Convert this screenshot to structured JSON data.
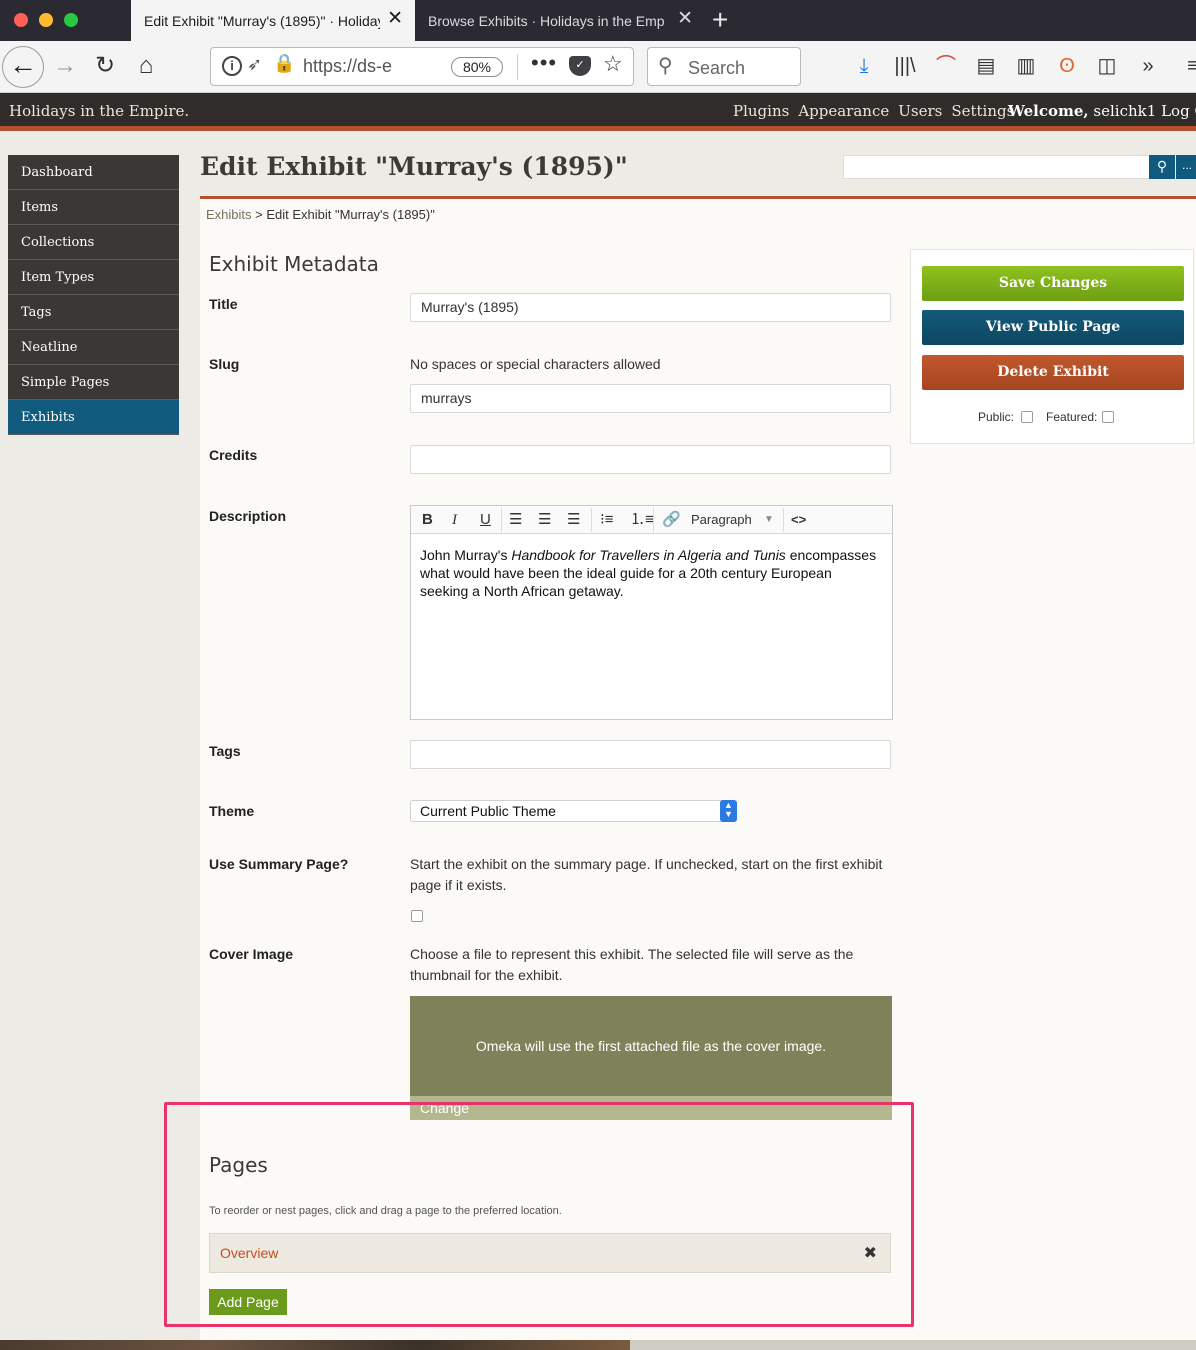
{
  "browser": {
    "tabs": [
      {
        "title": "Edit Exhibit \"Murray's (1895)\" · Holidays in the Empire",
        "close": "✕"
      },
      {
        "title": "Browse Exhibits · Holidays in the Empire",
        "close": "✕"
      }
    ],
    "new_tab": "+",
    "url": "https://ds-e",
    "zoom": "80%",
    "more": "•••",
    "search_placeholder": "Search"
  },
  "site": {
    "title": "Holidays in the Empire.",
    "nav": [
      "Plugins",
      "Appearance",
      "Users",
      "Settings"
    ],
    "welcome": "Welcome,",
    "username": "selichk1",
    "logout": "Log Out"
  },
  "sidebar": {
    "items": [
      {
        "label": "Dashboard"
      },
      {
        "label": "Items"
      },
      {
        "label": "Collections"
      },
      {
        "label": "Item Types"
      },
      {
        "label": "Tags"
      },
      {
        "label": "Neatline"
      },
      {
        "label": "Simple Pages"
      },
      {
        "label": "Exhibits"
      }
    ],
    "active": "Exhibits"
  },
  "page": {
    "heading": "Edit Exhibit \"Murray's (1895)\"",
    "search_button": "⚲",
    "search_more": "...",
    "breadcrumb_link": "Exhibits",
    "breadcrumb_rest": " > Edit Exhibit \"Murray's (1895)\""
  },
  "form": {
    "section_title": "Exhibit Metadata",
    "title_label": "Title",
    "title_value": "Murray's (1895)",
    "slug_label": "Slug",
    "slug_hint": "No spaces or special characters allowed",
    "slug_value": "murrays",
    "credits_label": "Credits",
    "credits_value": "",
    "description_label": "Description",
    "editor": {
      "bold": "B",
      "italic": "I",
      "underline": "U",
      "format": "Paragraph",
      "code": "<>"
    },
    "description": {
      "prefix": "John Murray's ",
      "italic": "Handbook for Travellers in Algeria and Tunis",
      "suffix": " encompasses what would have been the ideal guide for a 20th century European seeking a North African getaway."
    },
    "tags_label": "Tags",
    "tags_value": "",
    "theme_label": "Theme",
    "theme_value": "Current Public Theme",
    "summary_label": "Use Summary Page?",
    "summary_hint": "Start the exhibit on the summary page. If unchecked, start on the first exhibit page if it exists.",
    "summary_checked": false,
    "cover_label": "Cover Image",
    "cover_hint": "Choose a file to represent this exhibit. The selected file will serve as the thumbnail for the exhibit.",
    "cover_message": "Omeka will use the first attached file as the cover image.",
    "cover_change": "Change"
  },
  "pages": {
    "title": "Pages",
    "hint": "To reorder or nest pages, click and drag a page to the preferred location.",
    "items": [
      {
        "title": "Overview"
      }
    ],
    "delete_icon": "✖",
    "add_label": "Add Page"
  },
  "panel": {
    "save": "Save Changes",
    "view": "View Public Page",
    "delete": "Delete Exhibit",
    "public_label": "Public:",
    "featured_label": "Featured:",
    "public_checked": false,
    "featured_checked": false
  },
  "colors": {
    "accent": "#b5522d",
    "nav_active": "#0f5a7d",
    "save": "#7cb118",
    "delete": "#b44e25",
    "highlight": "#e8336b"
  }
}
